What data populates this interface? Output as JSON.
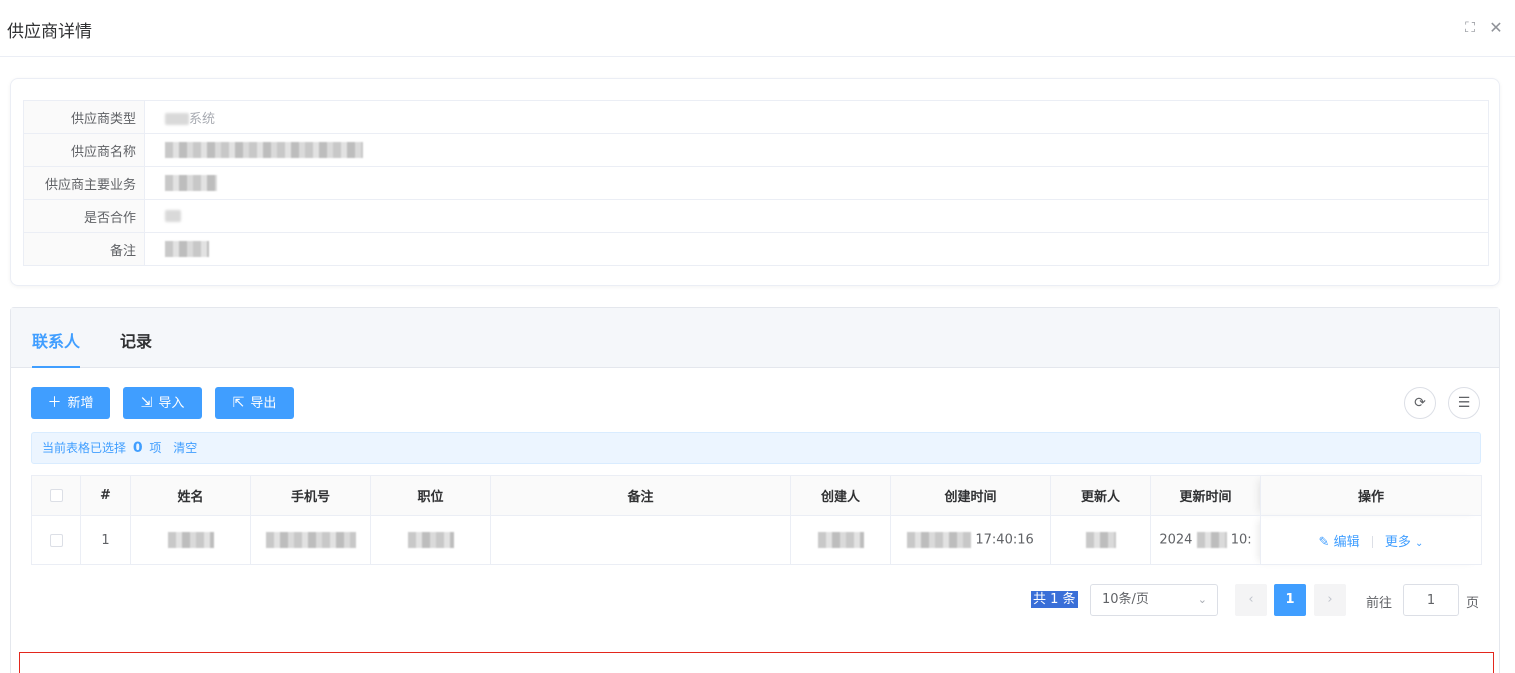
{
  "dialog": {
    "title": "供应商详情"
  },
  "info": {
    "rows": [
      {
        "label": "供应商类型",
        "value": "系统"
      },
      {
        "label": "供应商名称",
        "value": ""
      },
      {
        "label": "供应商主要业务",
        "value": ""
      },
      {
        "label": "是否合作",
        "value": ""
      },
      {
        "label": "备注",
        "value": ""
      }
    ]
  },
  "tabs": [
    {
      "label": "联系人",
      "active": true
    },
    {
      "label": "记录",
      "active": false
    }
  ],
  "toolbar": {
    "add_label": "新增",
    "import_label": "导入",
    "export_label": "导出"
  },
  "selection": {
    "prefix": "当前表格已选择",
    "count": "0",
    "suffix": "项",
    "clear_label": "清空"
  },
  "table": {
    "columns": [
      "#",
      "姓名",
      "手机号",
      "职位",
      "备注",
      "创建人",
      "创建时间",
      "更新人",
      "更新时间",
      "操作"
    ],
    "rows": [
      {
        "index": "1",
        "name": "",
        "phone": "",
        "position": "",
        "remark": "",
        "creator": "",
        "created_at": "17:40:16",
        "updater": "",
        "updated_at_start": "2024",
        "updated_at_end": "10:",
        "edit_label": "编辑",
        "more_label": "更多"
      }
    ]
  },
  "pagination": {
    "total_label": "共 1 条",
    "page_size": "10条/页",
    "current_page": "1",
    "goto_prefix": "前往",
    "goto_value": "1",
    "goto_suffix": "页"
  },
  "colors": {
    "primary": "#409eff",
    "highlight": "#3a6fd8",
    "annotation": "#e3271d"
  }
}
